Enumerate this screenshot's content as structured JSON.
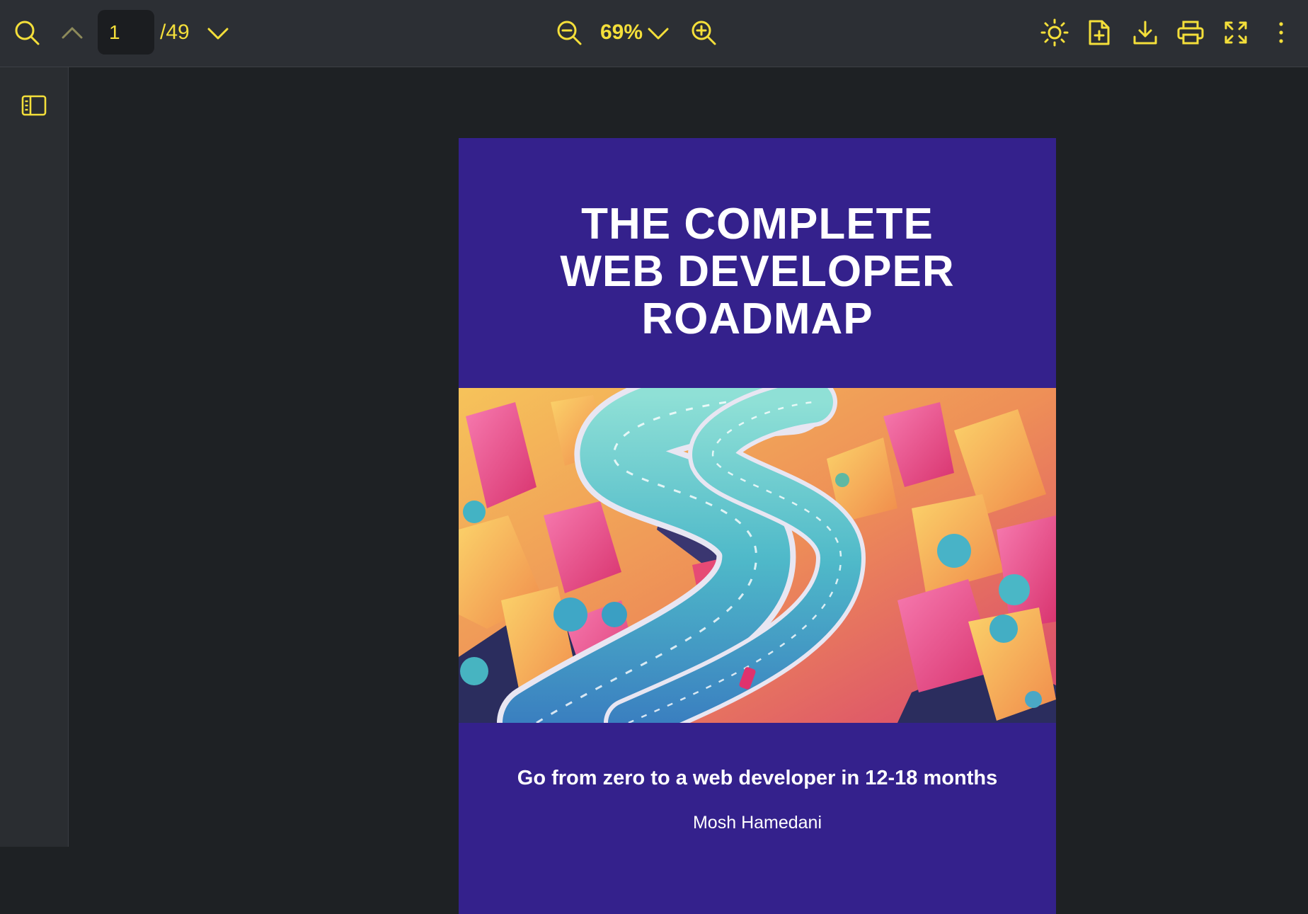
{
  "toolbar": {
    "search_icon": "search-icon",
    "prev_icon": "chevron-up-icon",
    "page_current": "1",
    "page_total": "/49",
    "next_icon": "chevron-down-icon",
    "zoom_out_icon": "zoom-out-icon",
    "zoom_level": "69%",
    "zoom_menu_icon": "chevron-down-icon",
    "zoom_in_icon": "zoom-in-icon",
    "theme_icon": "sun-icon",
    "add_file_icon": "file-plus-icon",
    "download_icon": "download-icon",
    "print_icon": "printer-icon",
    "fullscreen_icon": "expand-icon",
    "more_icon": "more-vertical-icon",
    "accent_color": "#f4df3a"
  },
  "sidebar": {
    "toggle_icon": "sidebar-panel-icon"
  },
  "document": {
    "title_lines": [
      "THE COMPLETE",
      "WEB DEVELOPER",
      "ROADMAP"
    ],
    "subtitle": "Go from zero to a web developer in 12-18 months",
    "author": "Mosh Hamedani",
    "cover_background": "#34218c"
  }
}
